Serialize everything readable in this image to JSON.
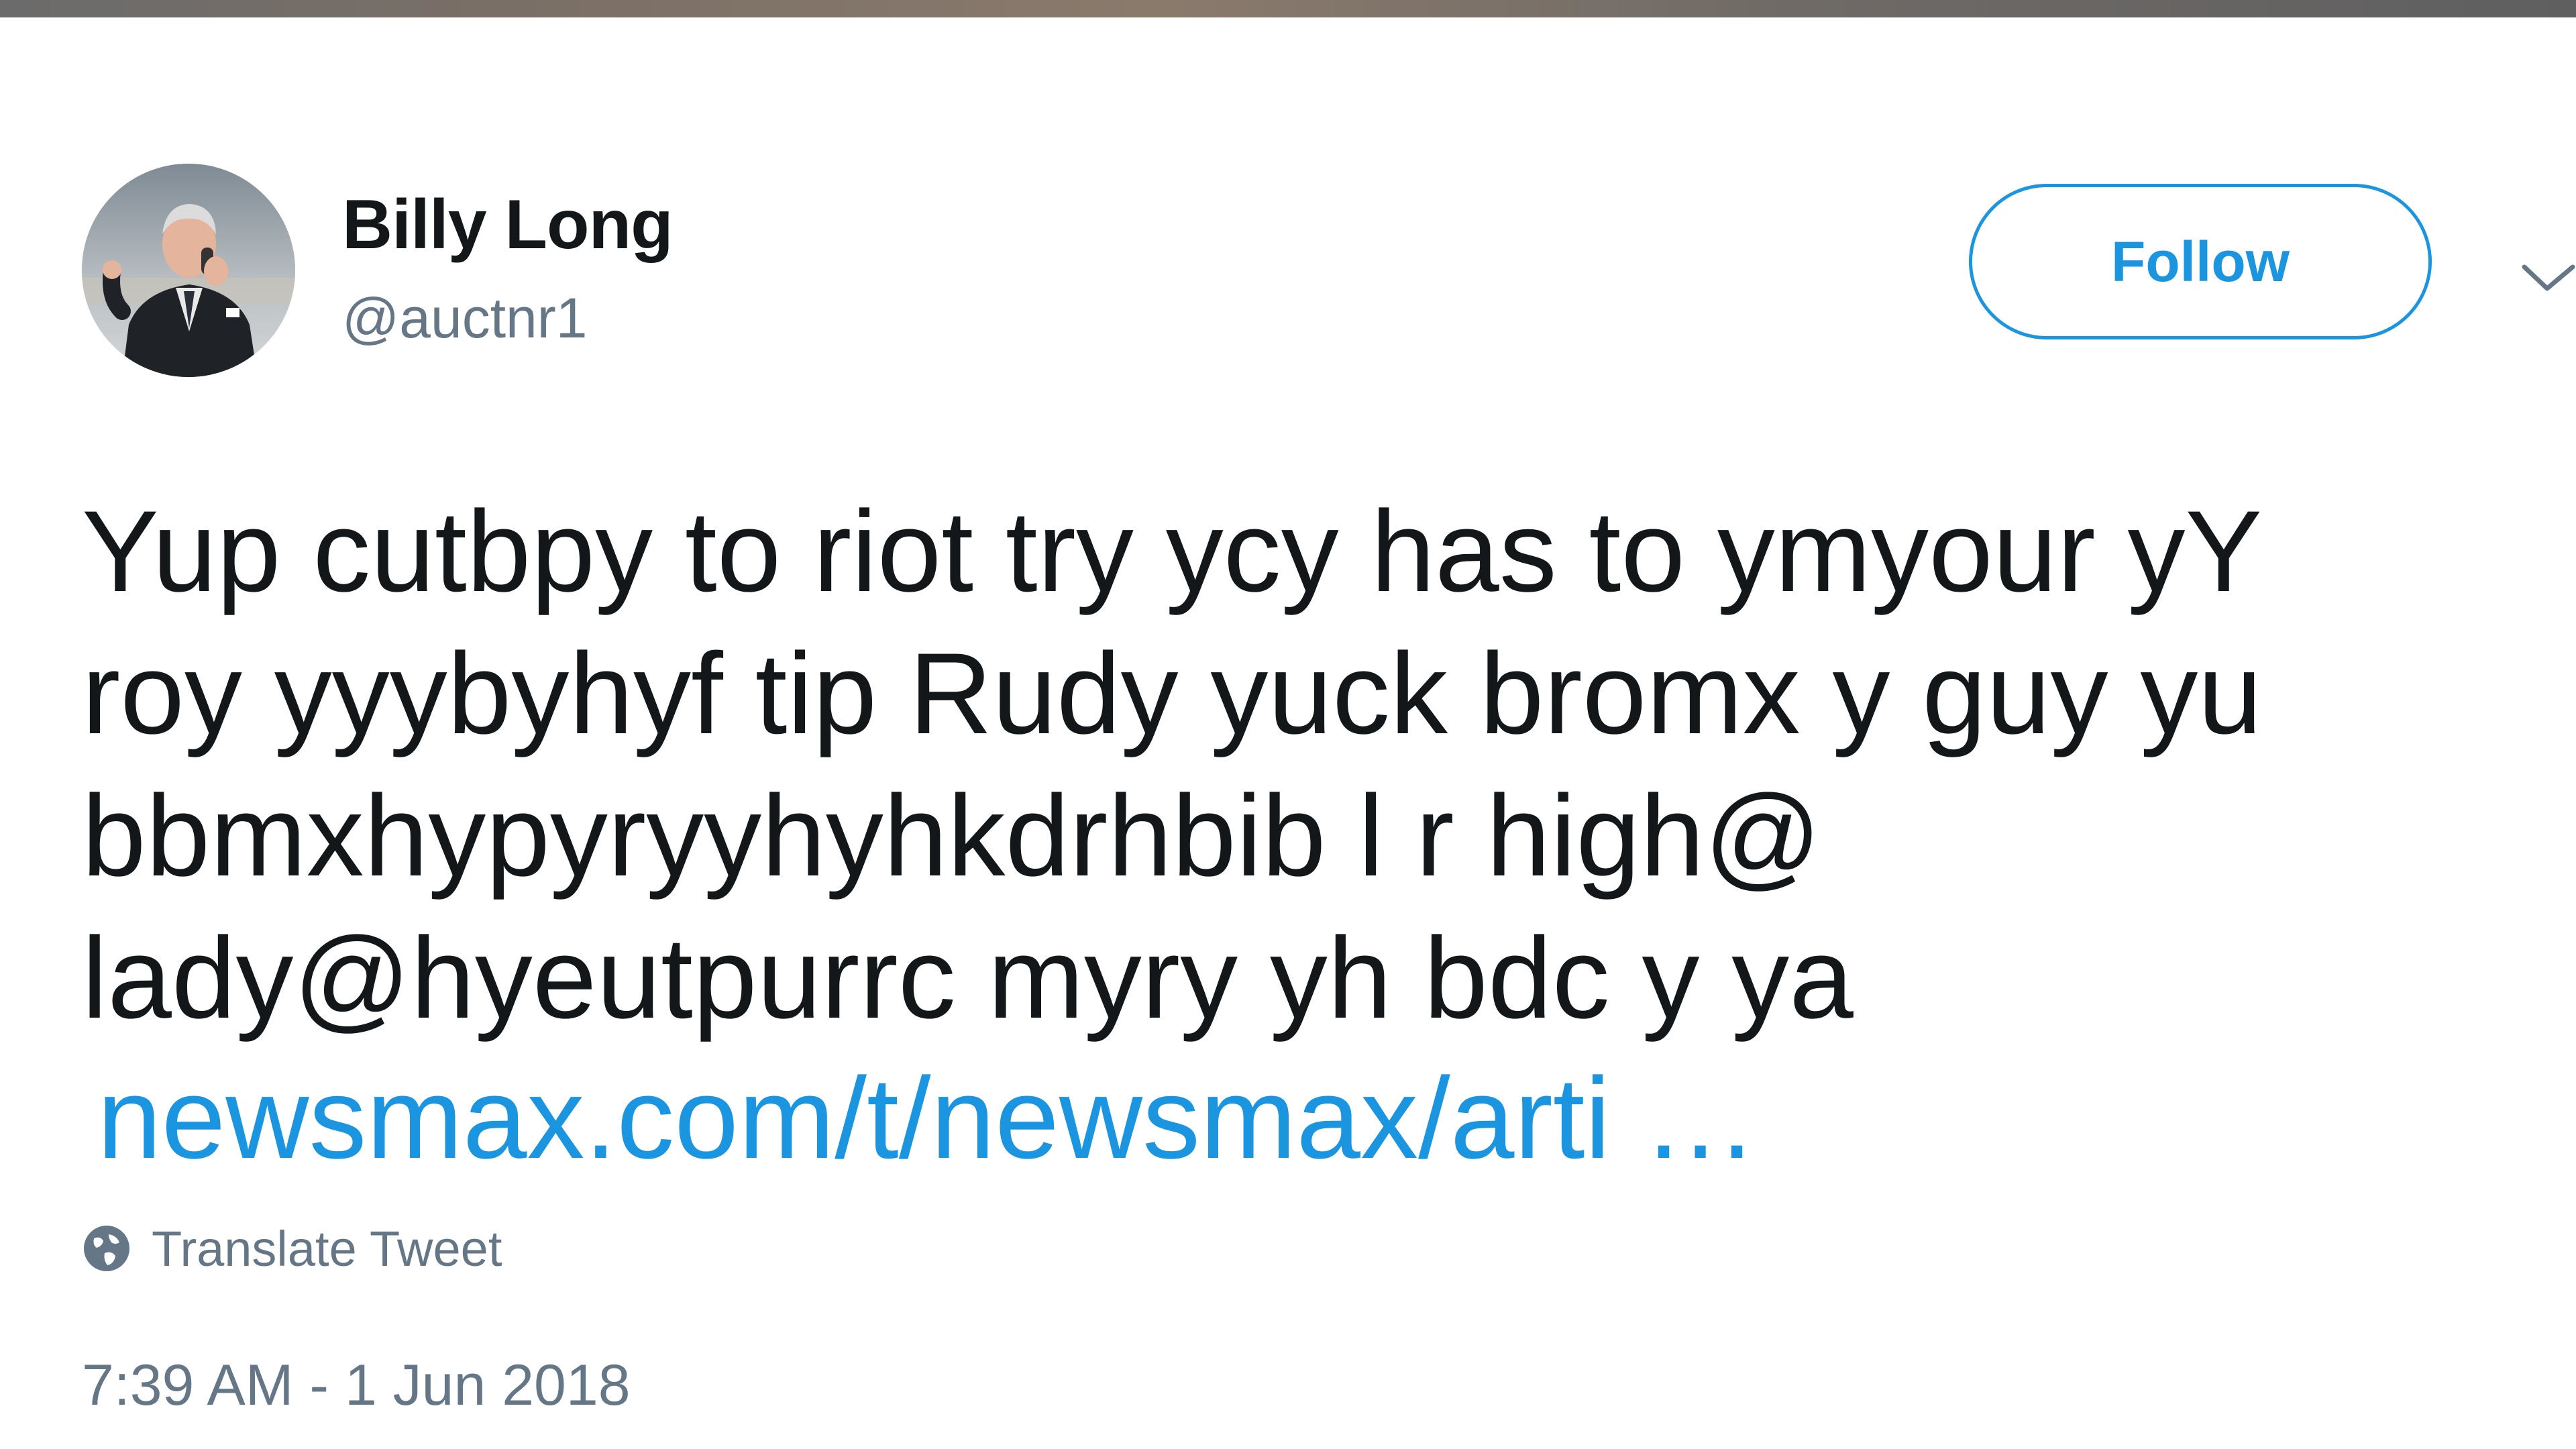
{
  "tweet": {
    "author": {
      "name": "Billy Long",
      "handle": "@auctnr1"
    },
    "follow_label": "Follow",
    "text": "Yup cutbpy to riot try ycy has to ymyour yY\nroy  yyybyhyf tip Rudy yuck bromx y guy yu\nbbmxhypyryyhyhkdrhbib l r high@\nlady@hyeutpurrc myry yh bdc y ya",
    "link": "newsmax.com/t/newsmax/arti …",
    "translate_label": "Translate Tweet",
    "timestamp": "7:39 AM - 1 Jun 2018"
  },
  "icons": {
    "menu": "chevron-down-icon",
    "translate": "globe-icon"
  },
  "colors": {
    "accent": "#1b95e0",
    "text": "#14171a",
    "secondary_text": "#657786",
    "background": "#ffffff"
  }
}
